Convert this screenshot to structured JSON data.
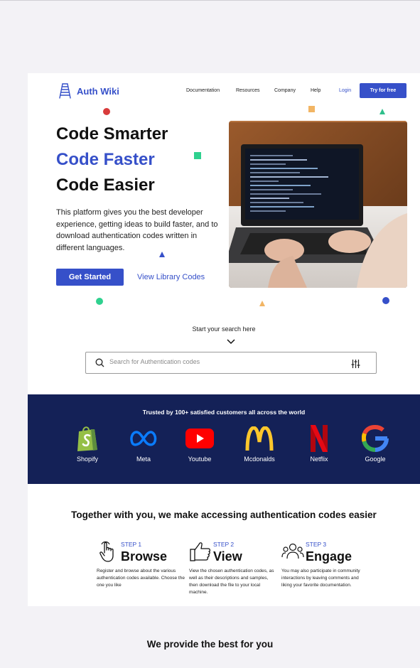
{
  "nav": {
    "logo_text": "Auth Wiki",
    "links": [
      "Documentation",
      "Resources",
      "Company",
      "Help"
    ],
    "login": "Login",
    "cta": "Try for free"
  },
  "hero": {
    "line1": "Code Smarter",
    "line2": "Code Faster",
    "line3": "Code Easier",
    "description": "This platform gives you the best developer experience, getting ideas to build faster, and to download authentication codes written in different languages.",
    "primary_button": "Get Started",
    "secondary_link": "View Library Codes"
  },
  "search": {
    "caption": "Start your search here",
    "placeholder": "Search for Authentication codes"
  },
  "trusted": {
    "title": "Trusted by 100+ satisfied customers all across the world",
    "brands": [
      {
        "name": "Shopify",
        "icon": "shopify-icon"
      },
      {
        "name": "Meta",
        "icon": "meta-icon"
      },
      {
        "name": "Youtube",
        "icon": "youtube-icon"
      },
      {
        "name": "Mcdonalds",
        "icon": "mcdonalds-icon"
      },
      {
        "name": "Netflix",
        "icon": "netflix-icon"
      },
      {
        "name": "Google",
        "icon": "google-icon"
      }
    ]
  },
  "steps_section": {
    "title": "Together with you, we make accessing authentication codes easier",
    "steps": [
      {
        "number": "STEP 1",
        "title": "Browse",
        "icon": "pointer-hand-icon",
        "text": "Register and browse about the various authentication codes available. Choose the one you like"
      },
      {
        "number": "STEP 2",
        "title": "View",
        "icon": "thumbs-up-icon",
        "text": "View the chosen authentication codes, as well as their descriptions and samples, then download the file to your local machine."
      },
      {
        "number": "STEP 3",
        "title": "Engage",
        "icon": "community-icon",
        "text": "You may also participate in community interactions by leaving comments and liking your favorite documentation."
      }
    ]
  },
  "bottom": {
    "title": "We provide the best for you"
  },
  "colors": {
    "brand_blue": "#3650c9",
    "navy": "#142157",
    "page_bg": "#f3f2f6"
  }
}
